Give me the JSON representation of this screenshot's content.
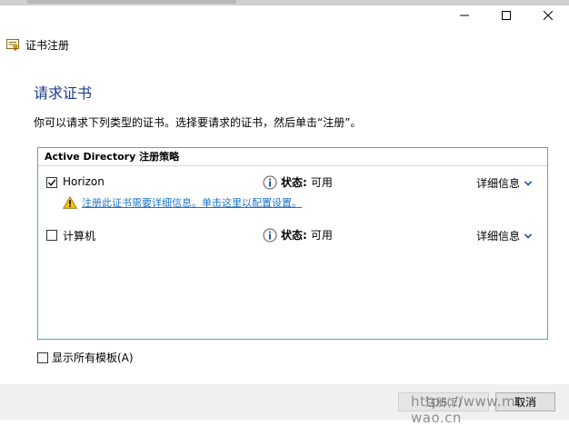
{
  "window": {
    "title": "证书注册",
    "controls": {
      "minimize_icon": "minimize-icon",
      "maximize_icon": "maximize-icon",
      "close_icon": "close-icon"
    }
  },
  "page": {
    "heading": "请求证书",
    "instruction": "你可以请求下列类型的证书。选择要请求的证书，然后单击“注册”。"
  },
  "policy_group": {
    "header": "Active Directory 注册策略",
    "items": [
      {
        "label": "Horizon",
        "checked": true,
        "status_key": "状态:",
        "status_value": "可用",
        "details_label": "详细信息",
        "warning": "注册此证书需要详细信息。单击这里以配置设置。"
      },
      {
        "label": "计算机",
        "checked": false,
        "status_key": "状态:",
        "status_value": "可用",
        "details_label": "详细信息"
      }
    ]
  },
  "show_all_templates": {
    "label": "显示所有模板(A)",
    "checked": false
  },
  "footer": {
    "register_label": "注册(E)",
    "cancel_label": "取消"
  },
  "watermark": "https://www.mr-wao.cn",
  "colors": {
    "heading": "#1e3c8c",
    "link": "#1a73c8",
    "list_border": "#4aa3df",
    "footer_bg": "#f0f0f0"
  }
}
